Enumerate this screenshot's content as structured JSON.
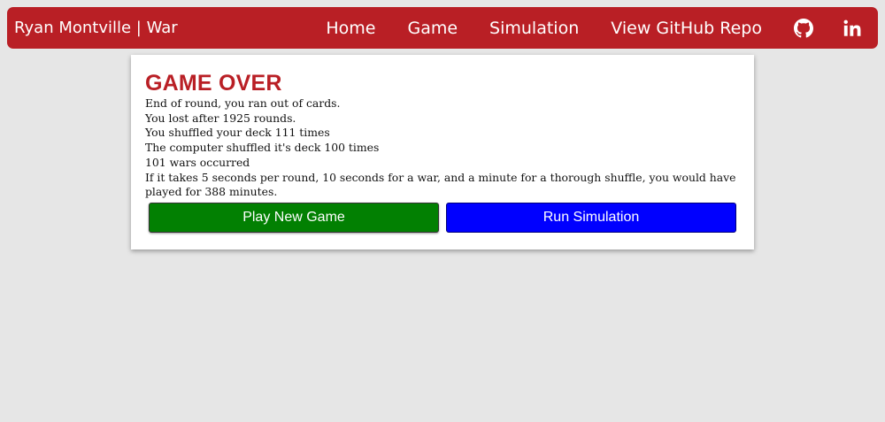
{
  "navbar": {
    "brand": "Ryan Montville | War",
    "links": [
      {
        "label": "Home"
      },
      {
        "label": "Game"
      },
      {
        "label": "Simulation"
      },
      {
        "label": "View GitHub Repo"
      }
    ],
    "icons": [
      "github-icon",
      "linkedin-icon"
    ],
    "color": "#b91f25"
  },
  "game_over": {
    "title": "GAME OVER",
    "lines": [
      "End of round, you ran out of cards.",
      "You lost after 1925 rounds.",
      "You shuffled your deck 111 times",
      "The computer shuffled it's deck 100 times",
      "101 wars occurred",
      "If it takes 5 seconds per round, 10 seconds for a war, and a minute for a thorough shuffle, you would have played for 388 minutes."
    ],
    "title_color": "#b91f25"
  },
  "buttons": {
    "play_new_game": "Play New Game",
    "run_simulation": "Run Simulation",
    "play_color": "#028002",
    "simulation_color": "#0000ff"
  }
}
